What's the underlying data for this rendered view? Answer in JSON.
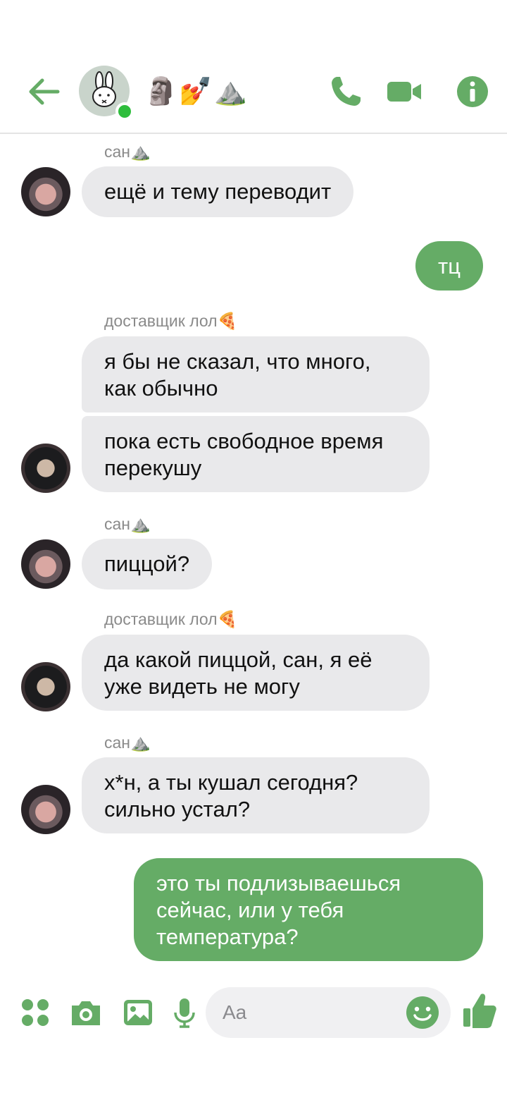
{
  "colors": {
    "accent": "#65ac66",
    "incoming_bubble": "#e9e9eb",
    "online": "#2ebd3c"
  },
  "header": {
    "title": "🗿💅⛰️",
    "icons": [
      "back-arrow-icon",
      "phone-icon",
      "video-camera-icon",
      "info-icon"
    ]
  },
  "messages": [
    {
      "sender": "сан⛰️",
      "text": "ещё и тему переводит"
    },
    {
      "outgoing": true,
      "text": "тц"
    },
    {
      "sender": "доставщик лол🍕",
      "text": "я бы не сказал, что много,\nкак обычно"
    },
    {
      "text": "пока есть свободное время\nперекушу"
    },
    {
      "sender": "сан⛰️",
      "text": "пиццой?"
    },
    {
      "sender": "доставщик лол🍕",
      "text": "да какой пиццой, сан, я её\nуже видеть не могу"
    },
    {
      "sender": "сан⛰️",
      "text": "х*н, а ты кушал сегодня?\nсильно устал?"
    },
    {
      "outgoing": true,
      "text": "это ты подлизываешься\nсейчас, или у тебя\nтемпература?"
    }
  ],
  "composer": {
    "placeholder": "Aa",
    "icons": [
      "apps-icon",
      "camera-icon",
      "image-icon",
      "microphone-icon",
      "emoji-icon",
      "thumbs-up-icon"
    ]
  }
}
